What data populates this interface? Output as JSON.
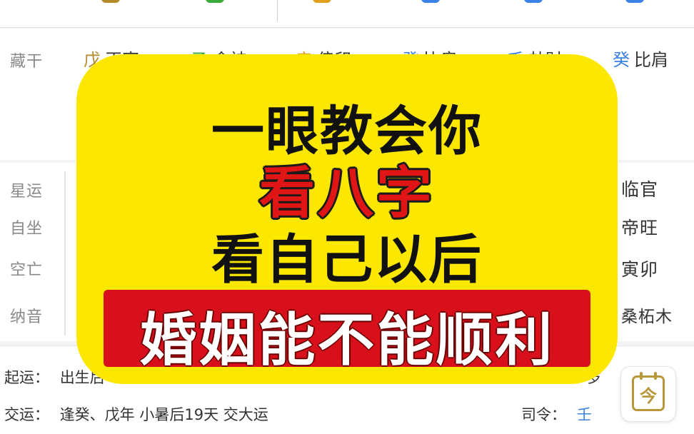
{
  "hidden_stems": {
    "label": "藏干",
    "items": [
      {
        "stem": "戊",
        "god": "正官",
        "color": "#b58a2a"
      },
      {
        "stem": "乙",
        "god": "食神",
        "color": "#3aaa3a"
      },
      {
        "stem": "辛",
        "god": "偏印",
        "color": "#e0a020"
      },
      {
        "stem": "癸",
        "god": "比肩",
        "color": "#3b82e6"
      },
      {
        "stem": "壬",
        "god": "劫财",
        "color": "#3b82e6"
      },
      {
        "stem": "癸",
        "god": "比肩",
        "color": "#3b82e6"
      }
    ]
  },
  "details": {
    "xingyun": {
      "label": "星运",
      "value": "临官"
    },
    "zizuo": {
      "label": "自坐",
      "value": "帝旺"
    },
    "kongwang": {
      "label": "空亡",
      "value": "寅卯"
    },
    "nayin": {
      "label": "纳音",
      "value": "桑柘木"
    }
  },
  "bottom": {
    "qiyun_label": "起运：",
    "qiyun_value": "出生后",
    "qiyun_tail": "岁",
    "jiaoyun_label": "交运：",
    "jiaoyun_value": "逢癸、戊年 小暑后19天 交大运",
    "siling_label": "司令：",
    "siling_value": "壬",
    "today_glyph": "今"
  },
  "overlay": {
    "line1": "一眼教会你",
    "line2": "看八字",
    "line3": "看自己以后",
    "line4": "婚姻能不能顺利"
  },
  "colors": {
    "overlay_yellow": "#fce700",
    "banner_red": "#d8101c",
    "accent_gold": "#b7973a"
  }
}
